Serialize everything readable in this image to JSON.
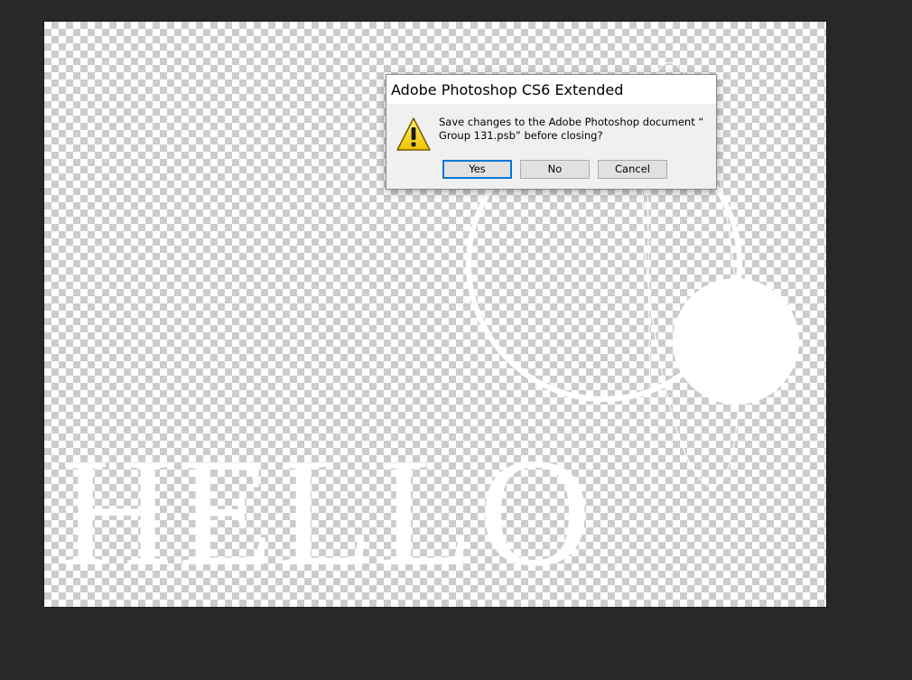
{
  "canvas": {
    "text": "HELLO"
  },
  "dialog": {
    "title": "Adobe Photoshop CS6 Extended",
    "message_line1": "Save changes to the Adobe Photoshop document “",
    "message_line2": "Group 131.psb” before closing?",
    "icon": "warning-icon",
    "buttons": {
      "yes": "Yes",
      "no": "No",
      "cancel": "Cancel"
    },
    "accent_color": "#0078d7"
  }
}
